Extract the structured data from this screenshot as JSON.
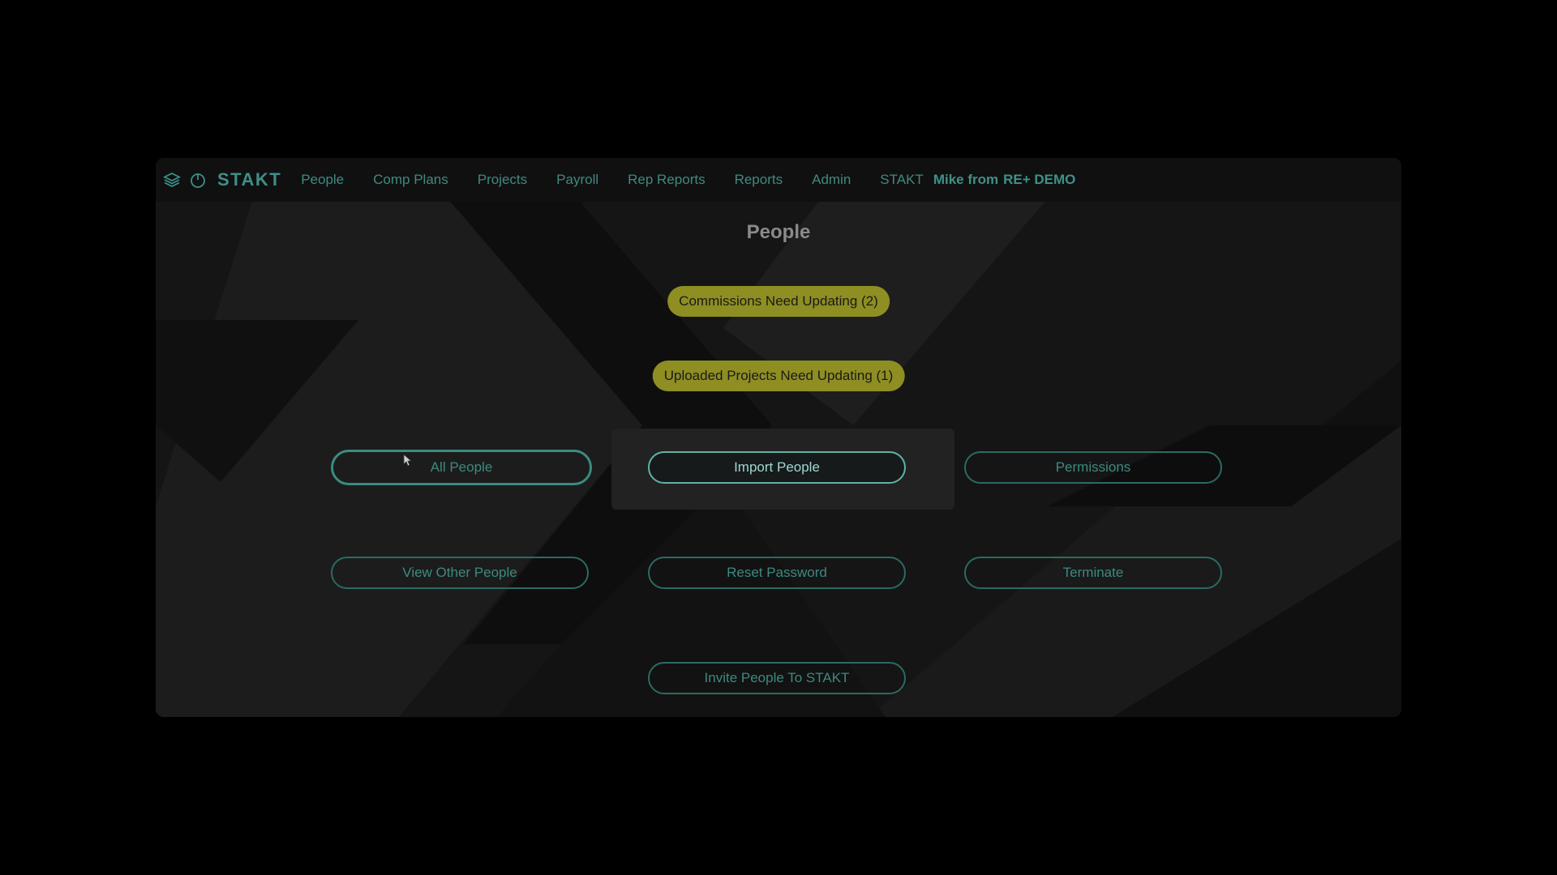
{
  "colors": {
    "accent": "#3e8f86",
    "badge_yellow": "#8e8e22",
    "background": "#141414"
  },
  "topbar": {
    "icons": [
      "layers-icon",
      "power-icon"
    ],
    "brand": "STAKT",
    "nav": [
      {
        "label": "People"
      },
      {
        "label": "Comp Plans"
      },
      {
        "label": "Projects"
      },
      {
        "label": "Payroll"
      },
      {
        "label": "Rep Reports"
      },
      {
        "label": "Reports"
      },
      {
        "label": "Admin"
      },
      {
        "label": "STAKT"
      }
    ],
    "user_prefix": "Mike from",
    "user_org": "RE+ DEMO"
  },
  "page": {
    "title": "People",
    "alerts": {
      "commissions": "Commissions Need Updating (2)",
      "uploaded": "Uploaded Projects Need Updating (1)"
    },
    "buttons": {
      "all_people": "All People",
      "import_people": "Import People",
      "permissions": "Permissions",
      "view_other": "View Other People",
      "reset_password": "Reset Password",
      "terminate": "Terminate",
      "invite": "Invite People To STAKT"
    }
  }
}
